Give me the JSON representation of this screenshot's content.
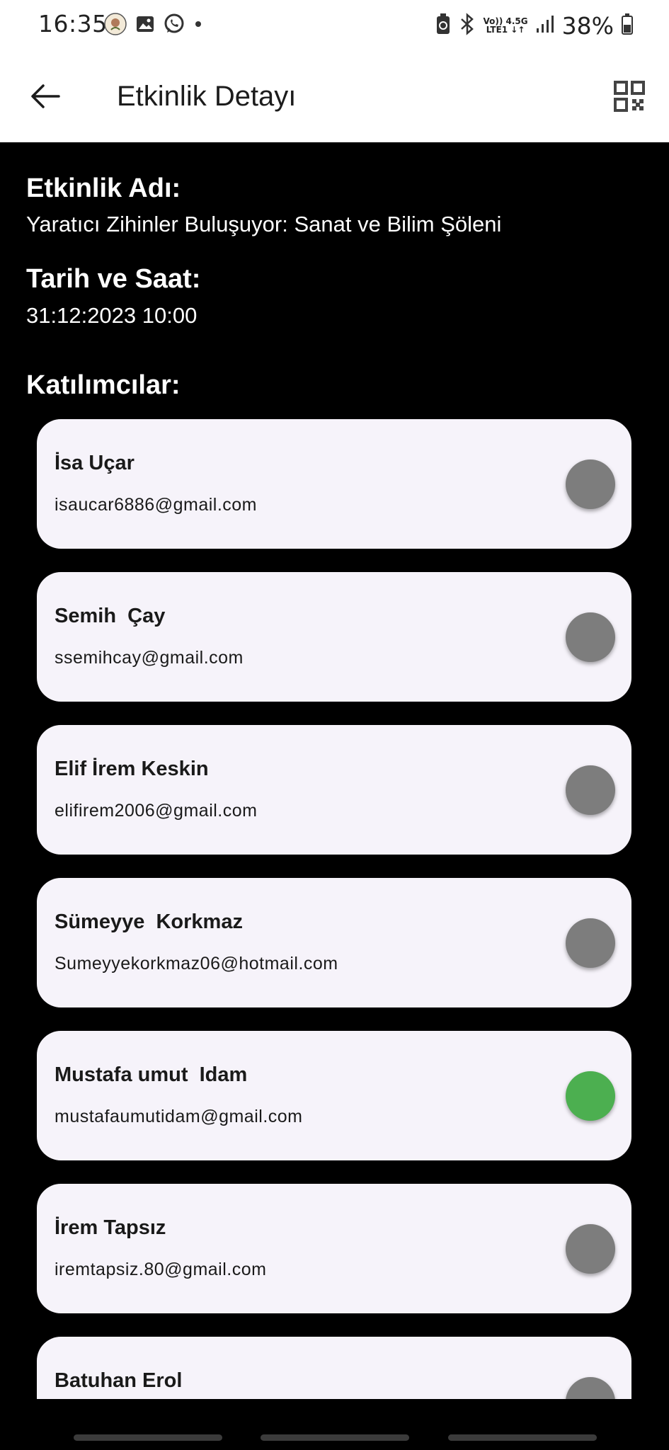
{
  "status_bar": {
    "time": "16:35",
    "left_icons": [
      "rose-avatar-icon",
      "gallery-icon",
      "whatsapp-icon",
      "notification-dot-icon"
    ],
    "network_top": "Vo)) 4.5G",
    "network_bottom": "LTE1 ↓↑",
    "battery": "38%"
  },
  "app_bar": {
    "title": "Etkinlik Detayı",
    "back_icon": "arrow-left-icon",
    "qr_icon": "qr-code-icon"
  },
  "event": {
    "name_label": "Etkinlik Adı:",
    "name_value": "Yaratıcı Zihinler Buluşuyor: Sanat ve Bilim Şöleni",
    "date_label": "Tarih ve Saat:",
    "date_value": "31:12:2023 10:00",
    "participants_label": "Katılımcılar:"
  },
  "participants": [
    {
      "name": "İsa Uçar",
      "email": "isaucar6886@gmail.com",
      "attended": false
    },
    {
      "name": "Semih  Çay",
      "email": "ssemihcay@gmail.com",
      "attended": false
    },
    {
      "name": "Elif İrem Keskin",
      "email": "elifirem2006@gmail.com",
      "attended": false
    },
    {
      "name": "Sümeyye  Korkmaz",
      "email": "Sumeyyekorkmaz06@hotmail.com",
      "attended": false
    },
    {
      "name": "Mustafa umut  Idam",
      "email": "mustafaumutidam@gmail.com",
      "attended": true
    },
    {
      "name": "İrem Tapsız",
      "email": "iremtapsiz.80@gmail.com",
      "attended": false
    },
    {
      "name": "Batuhan Erol",
      "email": "",
      "attended": false
    }
  ],
  "colors": {
    "toggle_off": "#7d7d7d",
    "toggle_on": "#4caf50",
    "card_bg": "#f6f3fa",
    "page_bg": "#000000"
  }
}
